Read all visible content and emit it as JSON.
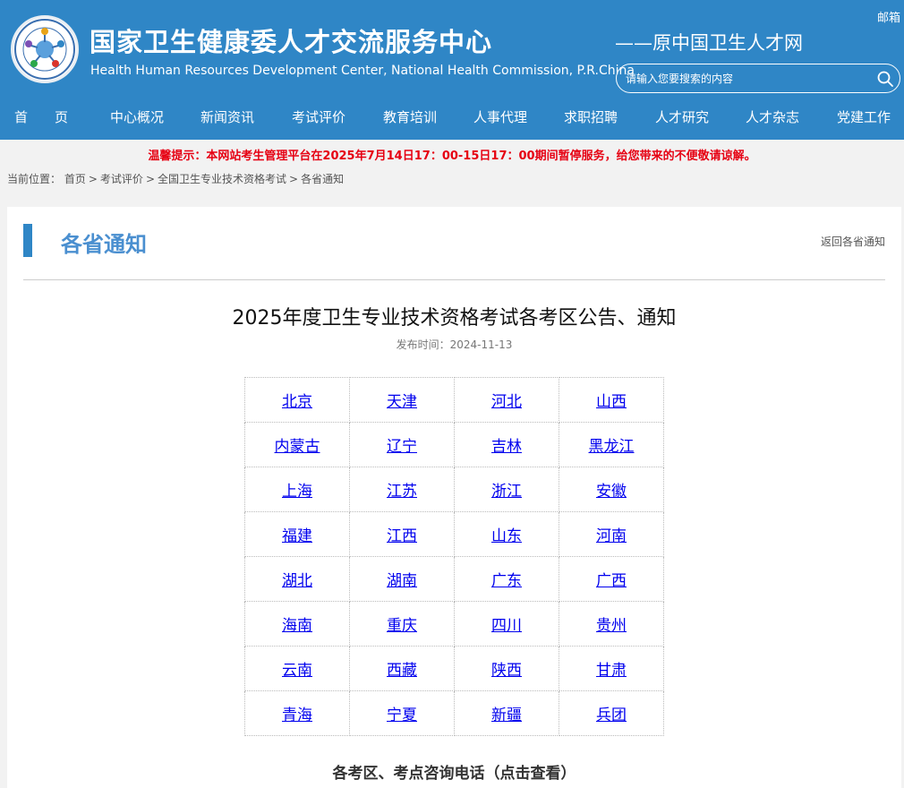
{
  "header": {
    "title": "国家卫生健康委人才交流服务中心",
    "subtitle": "Health Human Resources Development Center, National Health Commission, P.R.China",
    "old_name": "——原中国卫生人才网",
    "mail": "邮箱",
    "search_placeholder": "请输入您要搜索的内容",
    "colors": {
      "header_bg": "#2f86c6",
      "notice_red": "#e60012",
      "link_blue": "#0000ee",
      "section_title": "#4a8fd0"
    }
  },
  "nav": {
    "items": [
      "首　　页",
      "中心概况",
      "新闻资讯",
      "考试评价",
      "教育培训",
      "人事代理",
      "求职招聘",
      "人才研究",
      "人才杂志",
      "党建工作"
    ]
  },
  "notice": "温馨提示：本网站考生管理平台在2025年7月14日17：00-15日17：00期间暂停服务，给您带来的不便敬请谅解。",
  "breadcrumb": {
    "label": "当前位置：",
    "items": [
      "首页",
      "考试评价",
      "全国卫生专业技术资格考试",
      "各省通知"
    ],
    "sep": ">"
  },
  "section": {
    "title": "各省通知",
    "back_link": "返回各省通知"
  },
  "article": {
    "title": "2025年度卫生专业技术资格考试各考区公告、通知",
    "date_label": "发布时间：",
    "date": "2024-11-13"
  },
  "provinces": [
    [
      "北京",
      "天津",
      "河北",
      "山西"
    ],
    [
      "内蒙古",
      "辽宁",
      "吉林",
      "黑龙江"
    ],
    [
      "上海",
      "江苏",
      "浙江",
      "安徽"
    ],
    [
      "福建",
      "江西",
      "山东",
      "河南"
    ],
    [
      "湖北",
      "湖南",
      "广东",
      "广西"
    ],
    [
      "海南",
      "重庆",
      "四川",
      "贵州"
    ],
    [
      "云南",
      "西藏",
      "陕西",
      "甘肃"
    ],
    [
      "青海",
      "宁夏",
      "新疆",
      "兵团"
    ]
  ],
  "phone_title": "各考区、考点咨询电话（点击查看）"
}
